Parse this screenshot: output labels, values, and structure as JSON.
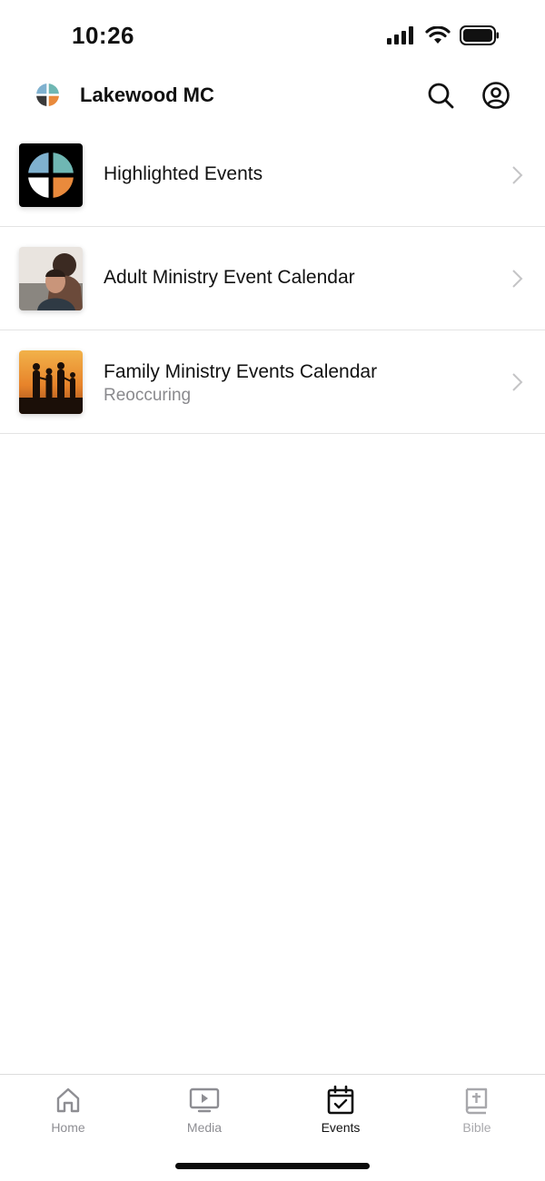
{
  "status_bar": {
    "time": "10:26"
  },
  "header": {
    "title": "Lakewood MC"
  },
  "events": [
    {
      "title": "Highlighted Events",
      "subtitle": ""
    },
    {
      "title": "Adult Ministry Event Calendar",
      "subtitle": ""
    },
    {
      "title": "Family Ministry Events Calendar",
      "subtitle": "Reoccuring"
    }
  ],
  "tabs": [
    {
      "label": "Home",
      "icon": "home-icon",
      "active": false
    },
    {
      "label": "Media",
      "icon": "media-icon",
      "active": false
    },
    {
      "label": "Events",
      "icon": "calendar-check-icon",
      "active": true
    },
    {
      "label": "Bible",
      "icon": "bible-icon",
      "active": false
    }
  ],
  "colors": {
    "logo_teal": "#6fb7b3",
    "logo_blue": "#7fb1cf",
    "logo_orange": "#e98a3c",
    "logo_dark": "#3a3a3a",
    "active_tab": "#111111",
    "inactive_tab": "#8e8e93",
    "subtitle": "#8a8a8e"
  }
}
